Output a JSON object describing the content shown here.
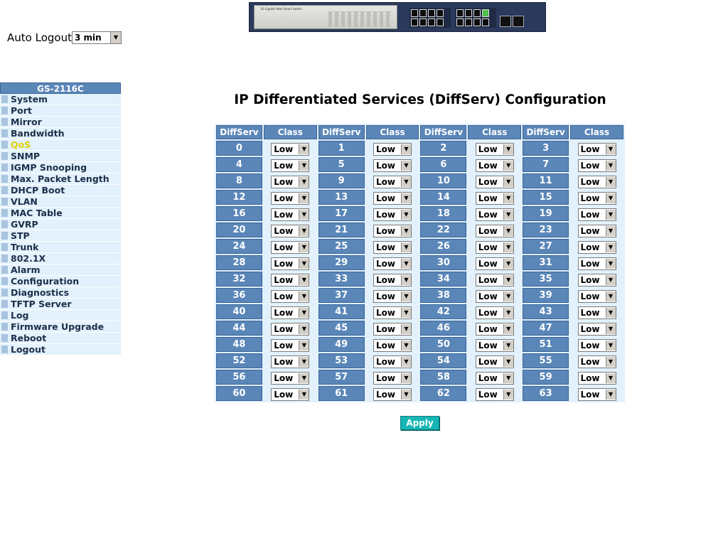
{
  "banner": {
    "image_name": "switch-front-panel",
    "model_text": "16-Gigabit Web Smart Switch"
  },
  "auto_logout": {
    "label": "Auto Logout",
    "value": "3 min"
  },
  "sidebar": {
    "header": "GS-2116C",
    "active_color": "#e0d000",
    "items": [
      {
        "label": "System"
      },
      {
        "label": "Port"
      },
      {
        "label": "Mirror"
      },
      {
        "label": "Bandwidth"
      },
      {
        "label": "QoS",
        "active": true
      },
      {
        "label": "SNMP"
      },
      {
        "label": "IGMP Snooping"
      },
      {
        "label": "Max. Packet Length"
      },
      {
        "label": "DHCP Boot"
      },
      {
        "label": "VLAN"
      },
      {
        "label": "MAC Table"
      },
      {
        "label": "GVRP"
      },
      {
        "label": "STP"
      },
      {
        "label": "Trunk"
      },
      {
        "label": "802.1X"
      },
      {
        "label": "Alarm"
      },
      {
        "label": "Configuration"
      },
      {
        "label": "Diagnostics"
      },
      {
        "label": "TFTP Server"
      },
      {
        "label": "Log"
      },
      {
        "label": "Firmware Upgrade"
      },
      {
        "label": "Reboot"
      },
      {
        "label": "Logout"
      }
    ]
  },
  "main": {
    "title": "IP Differentiated Services (DiffServ) Configuration",
    "columns": [
      "DiffServ",
      "Class",
      "DiffServ",
      "Class",
      "DiffServ",
      "Class",
      "DiffServ",
      "Class"
    ],
    "rows": [
      [
        {
          "ds": "0",
          "cls": "Low"
        },
        {
          "ds": "1",
          "cls": "Low"
        },
        {
          "ds": "2",
          "cls": "Low"
        },
        {
          "ds": "3",
          "cls": "Low"
        }
      ],
      [
        {
          "ds": "4",
          "cls": "Low"
        },
        {
          "ds": "5",
          "cls": "Low"
        },
        {
          "ds": "6",
          "cls": "Low"
        },
        {
          "ds": "7",
          "cls": "Low"
        }
      ],
      [
        {
          "ds": "8",
          "cls": "Low"
        },
        {
          "ds": "9",
          "cls": "Low"
        },
        {
          "ds": "10",
          "cls": "Low"
        },
        {
          "ds": "11",
          "cls": "Low"
        }
      ],
      [
        {
          "ds": "12",
          "cls": "Low"
        },
        {
          "ds": "13",
          "cls": "Low"
        },
        {
          "ds": "14",
          "cls": "Low"
        },
        {
          "ds": "15",
          "cls": "Low"
        }
      ],
      [
        {
          "ds": "16",
          "cls": "Low"
        },
        {
          "ds": "17",
          "cls": "Low"
        },
        {
          "ds": "18",
          "cls": "Low"
        },
        {
          "ds": "19",
          "cls": "Low"
        }
      ],
      [
        {
          "ds": "20",
          "cls": "Low"
        },
        {
          "ds": "21",
          "cls": "Low"
        },
        {
          "ds": "22",
          "cls": "Low"
        },
        {
          "ds": "23",
          "cls": "Low"
        }
      ],
      [
        {
          "ds": "24",
          "cls": "Low"
        },
        {
          "ds": "25",
          "cls": "Low"
        },
        {
          "ds": "26",
          "cls": "Low"
        },
        {
          "ds": "27",
          "cls": "Low"
        }
      ],
      [
        {
          "ds": "28",
          "cls": "Low"
        },
        {
          "ds": "29",
          "cls": "Low"
        },
        {
          "ds": "30",
          "cls": "Low"
        },
        {
          "ds": "31",
          "cls": "Low"
        }
      ],
      [
        {
          "ds": "32",
          "cls": "Low"
        },
        {
          "ds": "33",
          "cls": "Low"
        },
        {
          "ds": "34",
          "cls": "Low"
        },
        {
          "ds": "35",
          "cls": "Low"
        }
      ],
      [
        {
          "ds": "36",
          "cls": "Low"
        },
        {
          "ds": "37",
          "cls": "Low"
        },
        {
          "ds": "38",
          "cls": "Low"
        },
        {
          "ds": "39",
          "cls": "Low"
        }
      ],
      [
        {
          "ds": "40",
          "cls": "Low"
        },
        {
          "ds": "41",
          "cls": "Low"
        },
        {
          "ds": "42",
          "cls": "Low"
        },
        {
          "ds": "43",
          "cls": "Low"
        }
      ],
      [
        {
          "ds": "44",
          "cls": "Low"
        },
        {
          "ds": "45",
          "cls": "Low"
        },
        {
          "ds": "46",
          "cls": "Low"
        },
        {
          "ds": "47",
          "cls": "Low"
        }
      ],
      [
        {
          "ds": "48",
          "cls": "Low"
        },
        {
          "ds": "49",
          "cls": "Low"
        },
        {
          "ds": "50",
          "cls": "Low"
        },
        {
          "ds": "51",
          "cls": "Low"
        }
      ],
      [
        {
          "ds": "52",
          "cls": "Low"
        },
        {
          "ds": "53",
          "cls": "Low"
        },
        {
          "ds": "54",
          "cls": "Low"
        },
        {
          "ds": "55",
          "cls": "Low"
        }
      ],
      [
        {
          "ds": "56",
          "cls": "Low"
        },
        {
          "ds": "57",
          "cls": "Low"
        },
        {
          "ds": "58",
          "cls": "Low"
        },
        {
          "ds": "59",
          "cls": "Low"
        }
      ],
      [
        {
          "ds": "60",
          "cls": "Low"
        },
        {
          "ds": "61",
          "cls": "Low"
        },
        {
          "ds": "62",
          "cls": "Low"
        },
        {
          "ds": "63",
          "cls": "Low"
        }
      ]
    ],
    "apply_label": "Apply"
  },
  "colors": {
    "header_blue": "#5a86b8",
    "light_cell": "#e2f1fb",
    "apply_button": "#17b6b6"
  },
  "icons": {
    "dropdown_arrow": "triangle-down-icon",
    "menu_bullet": "square-bullet-icon"
  }
}
